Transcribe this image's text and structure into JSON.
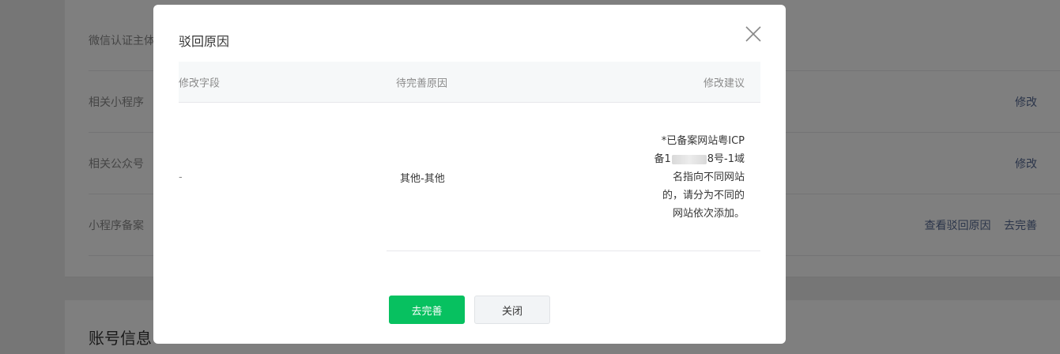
{
  "background": {
    "rows": [
      {
        "label": "微信认证主体",
        "actions": []
      },
      {
        "label": "相关小程序",
        "actions": [
          "修改"
        ]
      },
      {
        "label": "相关公众号",
        "actions": [
          "修改"
        ]
      },
      {
        "label": "小程序备案",
        "actions": [
          "查看驳回原因",
          "去完善"
        ]
      }
    ],
    "section_title": "账号信息"
  },
  "dialog": {
    "title": "驳回原因",
    "table": {
      "headers": [
        "修改字段",
        "待完善原因",
        "修改建议"
      ],
      "row": {
        "field": "-",
        "reason": "其他-其他",
        "suggestion_line1": "*已备案网站粤ICP",
        "suggestion_line2_prefix": "备1",
        "suggestion_line2_suffix": "8号-1域",
        "suggestion_line3": "名指向不同网站",
        "suggestion_line4": "的，请分为不同的",
        "suggestion_line5": "网站依次添加。"
      }
    },
    "buttons": {
      "primary": "去完善",
      "secondary": "关闭"
    }
  },
  "colors": {
    "primary": "#07c160",
    "link": "#576b95",
    "mask": "rgba(0,0,0,0.5)"
  }
}
